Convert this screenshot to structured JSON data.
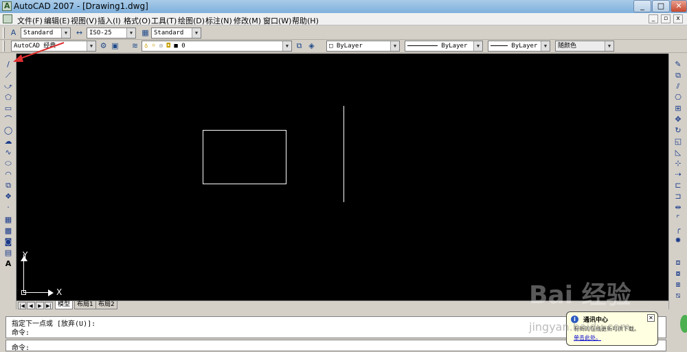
{
  "window": {
    "title": "AutoCAD 2007 - [Drawing1.dwg]",
    "min_label": "_",
    "max_label": "□",
    "close_label": "✕"
  },
  "menu": {
    "items": [
      "文件(F)",
      "编辑(E)",
      "视图(V)",
      "插入(I)",
      "格式(O)",
      "工具(T)",
      "绘图(D)",
      "标注(N)",
      "修改(M)",
      "窗口(W)",
      "帮助(H)"
    ],
    "mdi_min": "_",
    "mdi_restore": "▫",
    "mdi_close": "x"
  },
  "toolbar1": {
    "text_style": "Standard",
    "dim_style": "ISO-25",
    "table_style": "Standard"
  },
  "toolbar2": {
    "workspace": "AutoCAD 经典",
    "layer": "0",
    "color": "ByLayer",
    "linetype": "ByLayer",
    "lineweight": "ByLayer",
    "plotstyle": "随颜色"
  },
  "tabs": {
    "nav": [
      "|◀",
      "◀",
      "▶",
      "▶|"
    ],
    "items": [
      "模型",
      "布局1",
      "布局2"
    ],
    "active": "模型"
  },
  "ucs": {
    "x_label": "X",
    "y_label": "Y"
  },
  "command": {
    "history": [
      "指定下一点或 [放弃(U)]:",
      "命令:"
    ],
    "prompt": "命令:"
  },
  "balloon": {
    "title": "通讯中心",
    "message": "有新的在线更新可供下载。",
    "link": "单击此处。"
  },
  "watermark": {
    "text": "Bai 经验",
    "sub": "jingyan.baidu.com"
  },
  "colors": {
    "canvas": "#000000",
    "annotation_arrow": "#e03030",
    "titlebar": "#7fb0dc"
  }
}
